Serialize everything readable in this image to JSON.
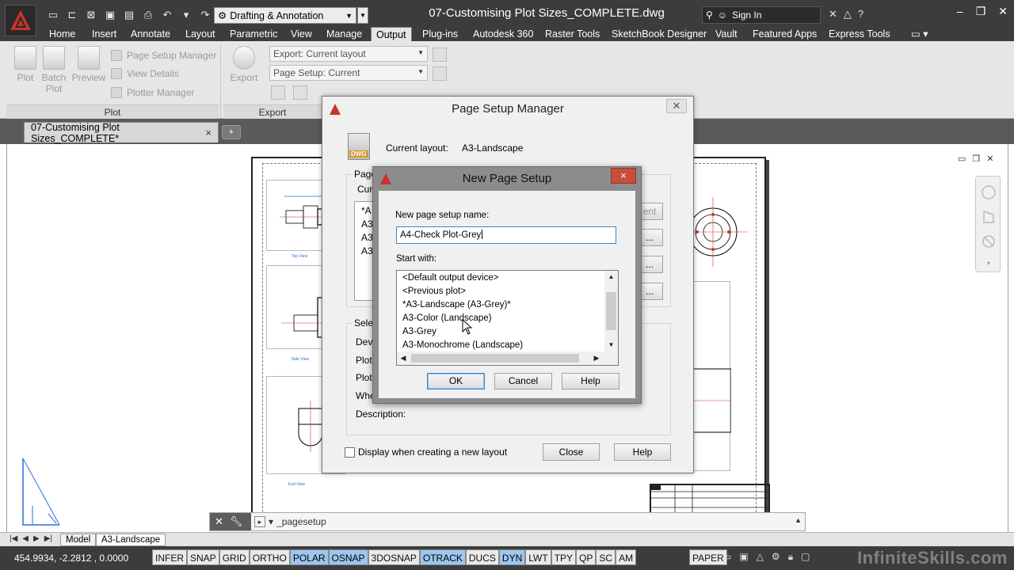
{
  "titlebar": {
    "workspace": "Drafting & Annotation",
    "document_title": "07-Customising Plot Sizes_COMPLETE.dwg",
    "sign_in": "Sign In",
    "help": "?"
  },
  "ribbon_tabs": [
    "Home",
    "Insert",
    "Annotate",
    "Layout",
    "Parametric",
    "View",
    "Manage",
    "Output",
    "Plug-ins",
    "Autodesk 360",
    "Raster Tools",
    "SketchBook Designer",
    "Vault",
    "Featured Apps",
    "Express Tools"
  ],
  "active_ribbon_tab": "Output",
  "ribbon": {
    "plot_label": "Plot",
    "batch_plot_label": "Batch Plot",
    "preview_label": "Preview",
    "page_setup_manager": "Page Setup Manager",
    "view_details": "View Details",
    "plotter_manager": "Plotter Manager",
    "plot_panel": "Plot",
    "export_label": "Export",
    "export_combo": "Export: Current layout",
    "page_setup_combo": "Page Setup: Current",
    "export_panel": "Export"
  },
  "file_tab": {
    "name": "07-Customising Plot Sizes_COMPLETE*",
    "close": "×"
  },
  "drawing": {
    "view_labels": [
      "Top View",
      "Side View",
      "End View"
    ]
  },
  "command_line": {
    "text": "_pagesetup"
  },
  "layout_tabs": [
    "Model",
    "A3-Landscape"
  ],
  "active_layout_tab": "A3-Landscape",
  "status_bar": {
    "coordinates": "454.9934, -2.2812 , 0.0000",
    "toggles": [
      {
        "label": "INFER",
        "on": false
      },
      {
        "label": "SNAP",
        "on": false
      },
      {
        "label": "GRID",
        "on": false
      },
      {
        "label": "ORTHO",
        "on": false
      },
      {
        "label": "POLAR",
        "on": true
      },
      {
        "label": "OSNAP",
        "on": true
      },
      {
        "label": "3DOSNAP",
        "on": false
      },
      {
        "label": "OTRACK",
        "on": true
      },
      {
        "label": "DUCS",
        "on": false
      },
      {
        "label": "DYN",
        "on": true
      },
      {
        "label": "LWT",
        "on": false
      },
      {
        "label": "TPY",
        "on": false
      },
      {
        "label": "QP",
        "on": false
      },
      {
        "label": "SC",
        "on": false
      },
      {
        "label": "AM",
        "on": false
      }
    ],
    "paper": "PAPER",
    "watermark": "InfiniteSkills.com"
  },
  "page_setup_manager": {
    "title": "Page Setup Manager",
    "current_layout_label": "Current layout:",
    "current_layout_value": "A3-Landscape",
    "page_setups_label": "Page",
    "current_label": "Curr",
    "list_items": [
      "*A",
      "A3",
      "A3",
      "A3"
    ],
    "right_btn_partial": "ent",
    "select_label": "Selec",
    "device_label": "Devi",
    "plotter_label": "Plott",
    "plot_size_label": "Plot",
    "where_label": "Whe",
    "description_label": "Description:",
    "display_checkbox": "Display when creating a new layout",
    "close_btn": "Close",
    "help_btn": "Help"
  },
  "new_page_setup": {
    "title": "New Page Setup",
    "name_label": "New page setup name:",
    "name_value": "A4-Check Plot-Grey",
    "start_with_label": "Start with:",
    "options": [
      "<Default output device>",
      "<Previous plot>",
      "*A3-Landscape (A3-Grey)*",
      "A3-Color (Landscape)",
      "A3-Grey",
      "A3-Monochrome (Landscape)"
    ],
    "ok_btn": "OK",
    "cancel_btn": "Cancel",
    "help_btn": "Help",
    "close": "×"
  }
}
